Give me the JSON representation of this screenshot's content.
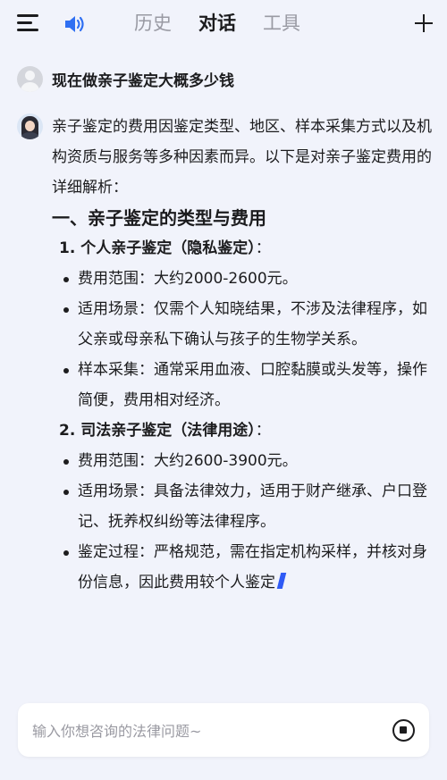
{
  "header": {
    "tabs": [
      {
        "label": "历史",
        "active": false
      },
      {
        "label": "对话",
        "active": true
      },
      {
        "label": "工具",
        "active": false
      }
    ]
  },
  "conversation": {
    "user_question": "现在做亲子鉴定大概多少钱",
    "answer": {
      "intro": "亲子鉴定的费用因鉴定类型、地区、样本采集方式以及机构资质与服务等多种因素而异。以下是对亲子鉴定费用的详细解析：",
      "section_title": "一、亲子鉴定的类型与费用",
      "subsections": [
        {
          "title": "1. 个人亲子鉴定（隐私鉴定）",
          "colon": "：",
          "bullets": [
            "费用范围：大约2000-2600元。",
            "适用场景：仅需个人知晓结果，不涉及法律程序，如父亲或母亲私下确认与孩子的生物学关系。",
            "样本采集：通常采用血液、口腔黏膜或头发等，操作简便，费用相对经济。"
          ]
        },
        {
          "title": "2. 司法亲子鉴定（法律用途）",
          "colon": "：",
          "bullets": [
            "费用范围：大约2600-3900元。",
            "适用场景：具备法律效力，适用于财产继承、户口登记、抚养权纠纷等法律程序。",
            "鉴定过程：严格规范，需在指定机构采样，并核对身份信息，因此费用较个人鉴定"
          ]
        }
      ]
    }
  },
  "input": {
    "placeholder": "输入你想咨询的法律问题~",
    "value": ""
  },
  "icons": {
    "menu": "menu-icon",
    "speaker": "speaker-icon",
    "add": "plus-icon",
    "stop": "stop-icon"
  },
  "colors": {
    "background": "#f1f3fb",
    "accent": "#2f5af5",
    "speaker": "#2f6ff2",
    "inactive_tab": "#999aa3"
  }
}
